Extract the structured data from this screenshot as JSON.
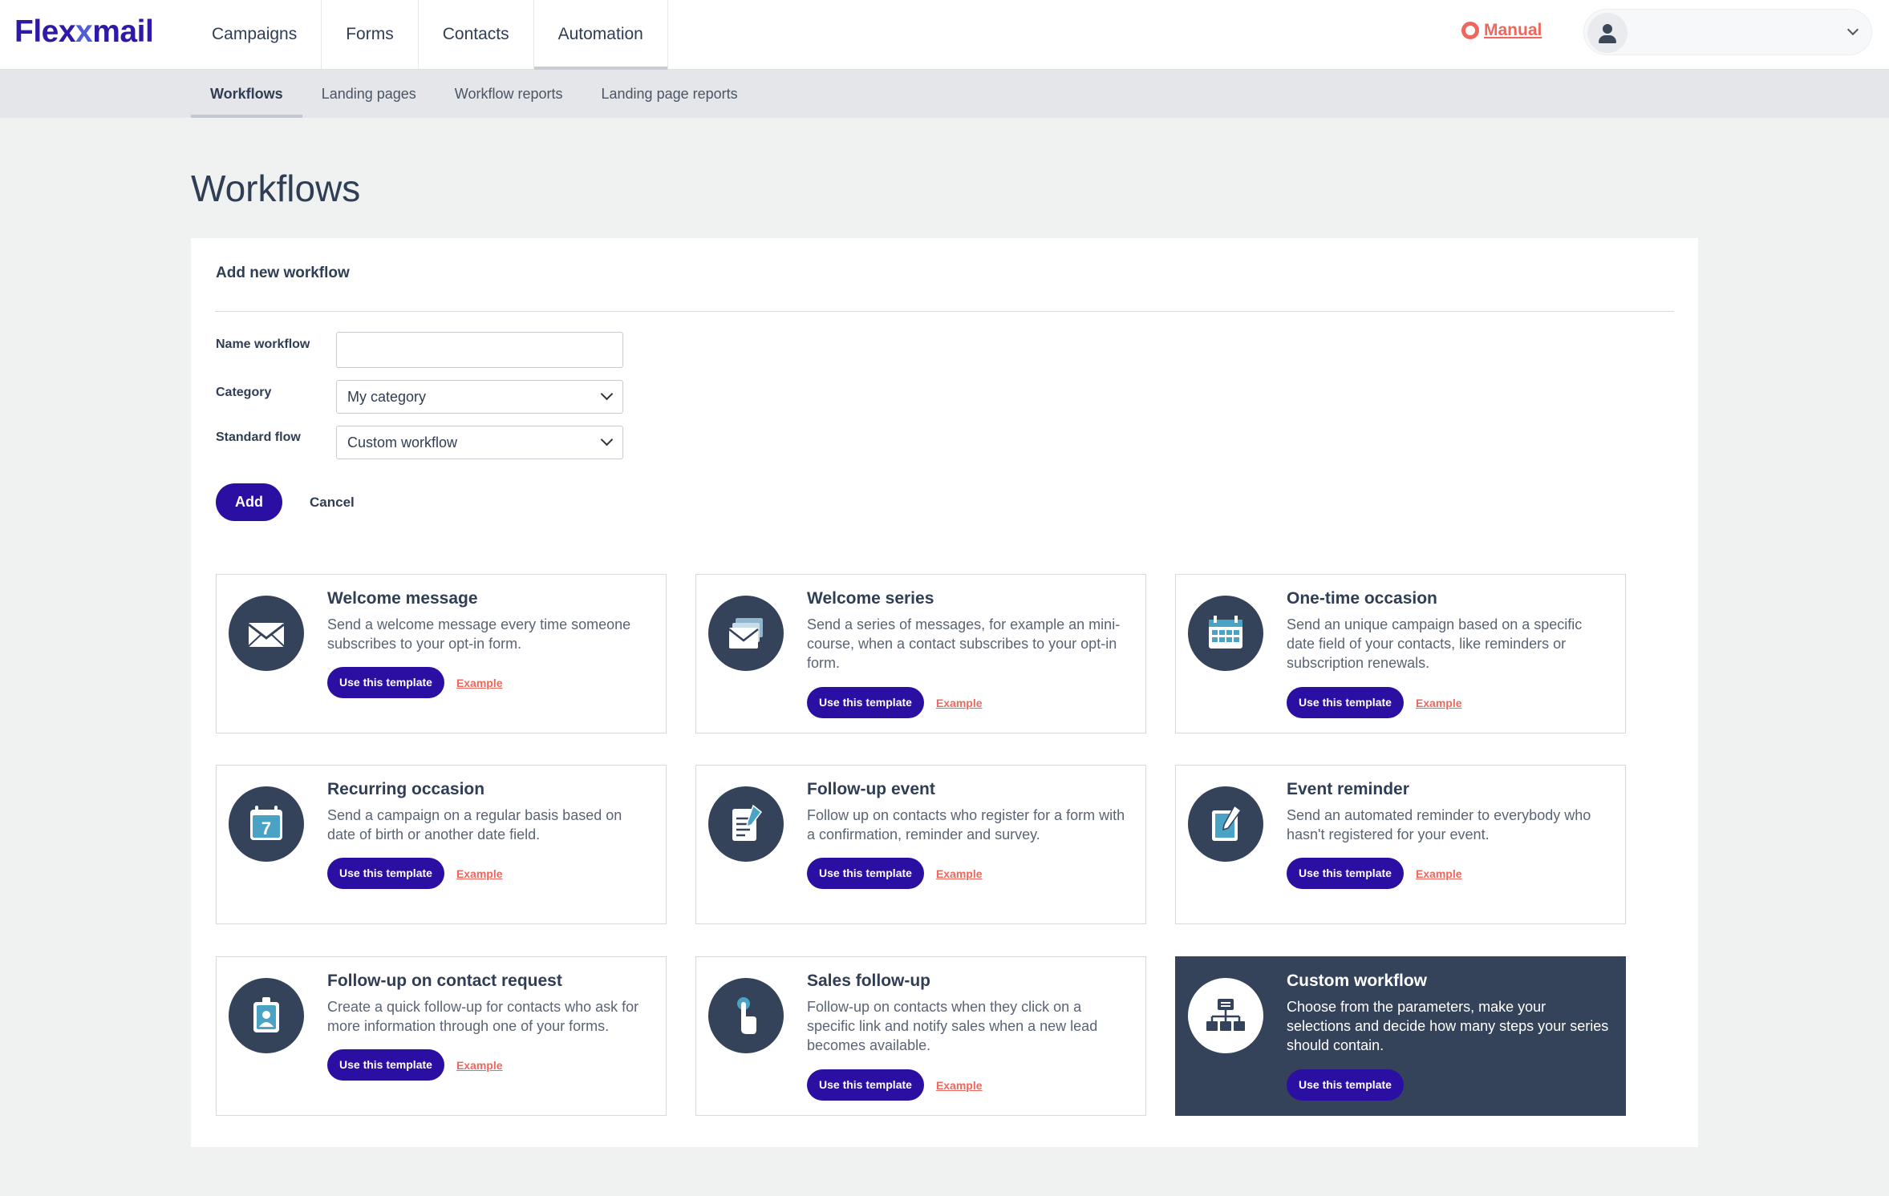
{
  "brand": {
    "logo_prefix": "Flex",
    "logo_x": "x",
    "logo_suffix": "mail"
  },
  "nav": {
    "items": [
      "Campaigns",
      "Forms",
      "Contacts",
      "Automation"
    ],
    "active": "Automation"
  },
  "header": {
    "manual_label": "Manual",
    "user_name": ""
  },
  "subnav": {
    "tabs": [
      "Workflows",
      "Landing pages",
      "Workflow reports",
      "Landing page reports"
    ],
    "active": "Workflows"
  },
  "page": {
    "title": "Workflows"
  },
  "form": {
    "title": "Add new workflow",
    "name_label": "Name workflow",
    "name_value": "",
    "category_label": "Category",
    "category_value": "My category",
    "flow_label": "Standard flow",
    "flow_value": "Custom workflow",
    "add_label": "Add",
    "cancel_label": "Cancel"
  },
  "templates": {
    "use_label": "Use this template",
    "example_label": "Example",
    "cards": [
      {
        "title": "Welcome message",
        "description": "Send a welcome message every time someone subscribes to your opt-in form.",
        "icon": "envelope-icon"
      },
      {
        "title": "Welcome series",
        "description": "Send a series of messages, for example an mini-course, when a contact subscribes to your opt-in form.",
        "icon": "envelopes-icon"
      },
      {
        "title": "One-time occasion",
        "description": "Send an unique campaign based on a specific date field of your contacts, like reminders or subscription renewals.",
        "icon": "calendar-icon"
      },
      {
        "title": "Recurring occasion",
        "description": "Send a campaign on a regular basis based on date of birth or another date field.",
        "icon": "calendar-day-icon",
        "icon_text": "7"
      },
      {
        "title": "Follow-up event",
        "description": "Follow up on contacts who register for a form with a confirmation, reminder and survey.",
        "icon": "form-edit-icon"
      },
      {
        "title": "Event reminder",
        "description": "Send an automated reminder to everybody who hasn't registered for your event.",
        "icon": "note-edit-icon"
      },
      {
        "title": "Follow-up on contact request",
        "description": "Create a quick follow-up for contacts who ask for more information through one of your forms.",
        "icon": "badge-icon"
      },
      {
        "title": "Sales follow-up",
        "description": "Follow-up on contacts when they click on a specific link and notify sales when a new lead becomes available.",
        "icon": "click-hand-icon"
      },
      {
        "title": "Custom workflow",
        "description": "Choose from the parameters, make your selections and decide how many steps your series should contain.",
        "icon": "hierarchy-icon"
      }
    ]
  },
  "colors": {
    "primary": "#2b0fa3",
    "dark_card": "#34425a",
    "link": "#f0665d",
    "background": "#f0f1f1"
  }
}
